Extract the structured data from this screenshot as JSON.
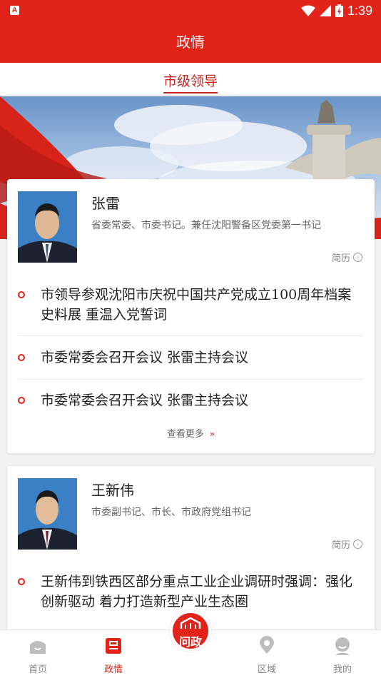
{
  "status_bar": {
    "time": "1:39",
    "app_badge": "A"
  },
  "header": {
    "title": "政情"
  },
  "tabs": [
    {
      "label": "市级领导",
      "active": true
    }
  ],
  "leaders": [
    {
      "name": "张雷",
      "title": "省委常委、市委书记。兼任沈阳警备区党委第一书记",
      "resume_label": "简历",
      "news": [
        "市领导参观沈阳市庆祝中国共产党成立100周年档案史料展 重温入党誓词",
        "市委常委会召开会议 张雷主持会议",
        "市委常委会召开会议 张雷主持会议"
      ],
      "more_label": "查看更多"
    },
    {
      "name": "王新伟",
      "title": "市委副书记、市长、市政府党组书记",
      "resume_label": "简历",
      "news": [
        "王新伟到铁西区部分重点工业企业调研时强调：强化创新驱动 着力打造新型产业生态圈"
      ]
    }
  ],
  "bottom_nav": {
    "items": [
      {
        "label": "首页",
        "icon": "home-icon"
      },
      {
        "label": "政情",
        "icon": "government-icon",
        "active": true
      },
      {
        "label": "问政",
        "icon": "wenzheng-logo"
      },
      {
        "label": "区域",
        "icon": "location-pin-icon"
      },
      {
        "label": "我的",
        "icon": "profile-icon"
      }
    ]
  },
  "colors": {
    "brand_red": "#e2231a",
    "tab_red": "#c4281f"
  }
}
